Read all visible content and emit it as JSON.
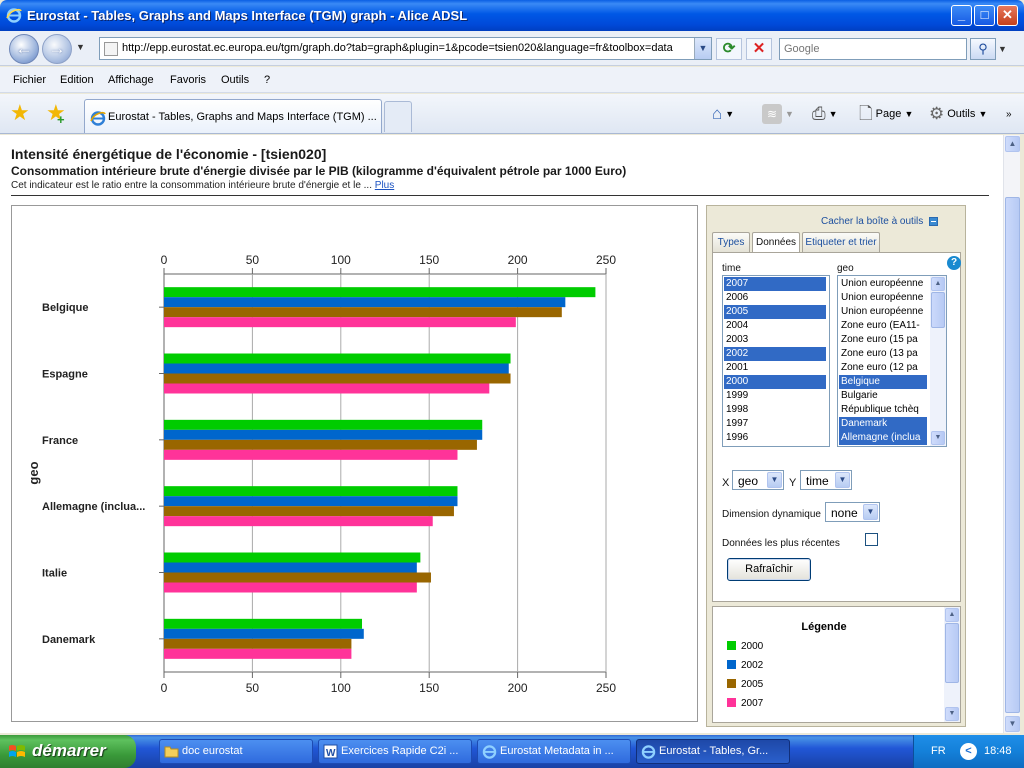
{
  "window": {
    "title": "Eurostat - Tables, Graphs and Maps Interface (TGM) graph - Alice ADSL",
    "controls": {
      "minimize": "_",
      "maximize": "□",
      "close": "✕"
    }
  },
  "addressbar": {
    "url": "http://epp.eurostat.ec.europa.eu/tgm/graph.do?tab=graph&plugin=1&pcode=tsien020&language=fr&toolbox=data",
    "search_placeholder": "Google"
  },
  "menu": [
    "Fichier",
    "Edition",
    "Affichage",
    "Favoris",
    "Outils",
    "?"
  ],
  "tabs": [
    {
      "label": "Eurostat - Tables, Graphs and Maps Interface (TGM) ..."
    }
  ],
  "commands": {
    "page": "Page",
    "tools": "Outils"
  },
  "page": {
    "title": "Intensité énergétique de l'économie - [tsien020]",
    "subtitle": "Consommation intérieure brute d'énergie divisée par le PIB (kilogramme d'équivalent pétrole par 1000 Euro)",
    "description": "Cet indicateur est le ratio entre la consommation intérieure brute d'énergie et le ...",
    "more_link": "Plus"
  },
  "toolbox": {
    "hide_label": "Cacher la boîte à outils",
    "tabs": [
      "Types",
      "Données",
      "Etiqueter et trier"
    ],
    "active_tab": "Données",
    "help": "?",
    "time_label": "time",
    "geo_label": "geo",
    "time_options": [
      {
        "label": "2007",
        "selected": true
      },
      {
        "label": "2006",
        "selected": false
      },
      {
        "label": "2005",
        "selected": true
      },
      {
        "label": "2004",
        "selected": false
      },
      {
        "label": "2003",
        "selected": false
      },
      {
        "label": "2002",
        "selected": true
      },
      {
        "label": "2001",
        "selected": false
      },
      {
        "label": "2000",
        "selected": true
      },
      {
        "label": "1999",
        "selected": false
      },
      {
        "label": "1998",
        "selected": false
      },
      {
        "label": "1997",
        "selected": false
      },
      {
        "label": "1996",
        "selected": false
      }
    ],
    "geo_options": [
      {
        "label": "Union européenne",
        "selected": false
      },
      {
        "label": "Union européenne",
        "selected": false
      },
      {
        "label": "Union européenne",
        "selected": false
      },
      {
        "label": "Zone euro (EA11-",
        "selected": false
      },
      {
        "label": "Zone euro (15 pa",
        "selected": false
      },
      {
        "label": "Zone euro (13 pa",
        "selected": false
      },
      {
        "label": "Zone euro (12 pa",
        "selected": false
      },
      {
        "label": "Belgique",
        "selected": true
      },
      {
        "label": "Bulgarie",
        "selected": false
      },
      {
        "label": "République tchèq",
        "selected": false
      },
      {
        "label": "Danemark",
        "selected": true
      },
      {
        "label": "Allemagne (inclua",
        "selected": true
      }
    ],
    "x_label": "X",
    "x_value": "geo",
    "y_label": "Y",
    "y_value": "time",
    "dynamic_label": "Dimension dynamique",
    "dynamic_value": "none",
    "recent_label": "Données les plus récentes",
    "recent_checked": false,
    "refresh_label": "Rafraîchir",
    "legend_title": "Légende"
  },
  "chart_data": {
    "type": "bar",
    "orientation": "horizontal",
    "ylabel": "geo",
    "categories": [
      "Belgique",
      "Espagne",
      "France",
      "Allemagne (inclua...",
      "Italie",
      "Danemark"
    ],
    "xlim": [
      0,
      250
    ],
    "xticks": [
      0,
      50,
      100,
      150,
      200,
      250
    ],
    "grid": true,
    "series": [
      {
        "name": "2000",
        "color": "#00cc00",
        "values": [
          244,
          196,
          180,
          166,
          145,
          112
        ]
      },
      {
        "name": "2002",
        "color": "#0066cc",
        "values": [
          227,
          195,
          180,
          166,
          143,
          113
        ]
      },
      {
        "name": "2005",
        "color": "#996600",
        "values": [
          225,
          196,
          177,
          164,
          151,
          106
        ]
      },
      {
        "name": "2007",
        "color": "#ff3399",
        "values": [
          199,
          184,
          166,
          152,
          143,
          106
        ]
      }
    ]
  },
  "taskbar": {
    "start_label": "démarrer",
    "tasks": [
      {
        "label": "doc eurostat",
        "active": false
      },
      {
        "label": "Exercices Rapide C2i ...",
        "active": false
      },
      {
        "label": "Eurostat Metadata in ...",
        "active": false
      },
      {
        "label": "Eurostat - Tables, Gr...",
        "active": true
      }
    ],
    "lang": "FR",
    "time": "18:48"
  }
}
